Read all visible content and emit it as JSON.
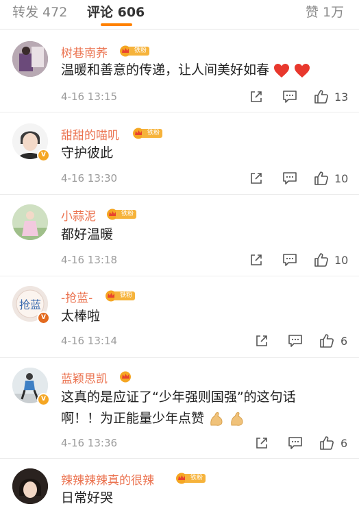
{
  "tabs": [
    {
      "label": "转发 472"
    },
    {
      "label": "评论 606"
    },
    {
      "label": "赞 1万"
    }
  ],
  "fan_badge_label": "铁粉",
  "comments": [
    {
      "name": "树巷南荞",
      "text": "温暖和善意的传递，让人间美好如春",
      "emoji": "❤ ❤",
      "time": "4-16 13:15",
      "likes": "13"
    },
    {
      "name": "甜甜的喵叽",
      "text": "守护彼此",
      "time": "4-16 13:30",
      "likes": "10"
    },
    {
      "name": "小蒜泥",
      "text": "都好温暖",
      "time": "4-16 13:18",
      "likes": "10"
    },
    {
      "name": "-抢蓝-",
      "text": "太棒啦",
      "time": "4-16 13:14",
      "likes": "6",
      "avatar_text": "抢蓝"
    },
    {
      "name": "蓝颖思凯",
      "text_line1": "这真的是应证了“少年强则国强”的这句话",
      "text_line2": "啊！！为正能量少年点赞",
      "time": "4-16 13:36",
      "likes": "6"
    },
    {
      "name": "辣辣辣辣真的很辣",
      "text": "日常好哭"
    }
  ]
}
